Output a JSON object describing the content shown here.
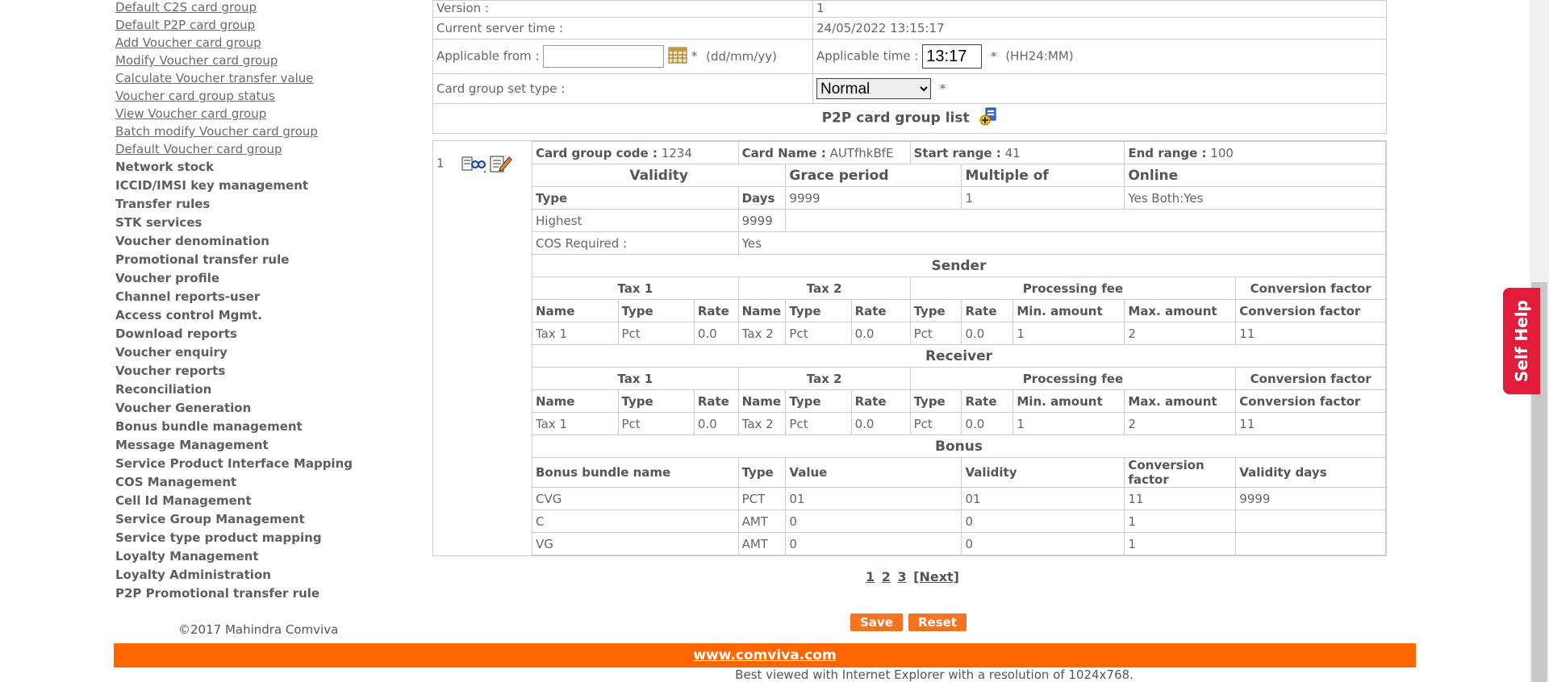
{
  "sidebar": {
    "links": [
      "Default C2S card group",
      "Default P2P card group",
      "Add Voucher card group",
      "Modify Voucher card group",
      "Calculate Voucher transfer value",
      "Voucher card group status",
      "View Voucher card group",
      "Batch modify Voucher card group",
      "Default Voucher card group"
    ],
    "menus": [
      "Network stock",
      "ICCID/IMSI key management",
      "Transfer rules",
      "STK services",
      "Voucher denomination",
      "Promotional transfer rule",
      "Voucher profile",
      "Channel reports-user",
      "Access control Mgmt.",
      "Download reports",
      "Voucher enquiry",
      "Voucher reports",
      "Reconciliation",
      "Voucher Generation",
      "Bonus bundle management",
      "Message Management",
      "Service Product Interface Mapping",
      "COS Management",
      "Cell Id Management",
      "Service Group Management",
      "Service type product mapping",
      "Loyalty Management",
      "Loyalty Administration",
      "P2P Promotional transfer rule"
    ]
  },
  "copyright": "©2017 Mahindra Comviva",
  "form": {
    "version_label": "Version :",
    "version_value": "1",
    "server_time_label": "Current server time :",
    "server_time_value": "24/05/2022 13:15:17",
    "applicable_from_label": "Applicable from :",
    "applicable_from_value": "",
    "date_format": "(dd/mm/yy)",
    "applicable_time_label": "Applicable time :",
    "applicable_time_value": "13:17",
    "time_format": "(HH24:MM)",
    "set_type_label": "Card group set type :",
    "set_type_value": "Normal",
    "required_mark": "*"
  },
  "list_title": "P2P card group list",
  "card": {
    "index": "1",
    "code_label": "Card group code :",
    "code_value": "1234",
    "name_label": "Card Name :",
    "name_value": "AUTfhkBfE",
    "start_label": "Start range :",
    "start_value": "41",
    "end_label": "End range :",
    "end_value": "100",
    "h_validity": "Validity",
    "h_grace": "Grace period",
    "h_multiple": "Multiple of",
    "h_online": "Online",
    "type_label": "Type",
    "days_label": "Days",
    "grace_value": "9999",
    "multiple_value": "1",
    "online_value": "Yes Both:Yes",
    "validity_type": "Highest",
    "validity_days": "9999",
    "cos_label": "COS Required :",
    "cos_value": "Yes",
    "sender_title": "Sender",
    "receiver_title": "Receiver",
    "tax1": "Tax 1",
    "tax2": "Tax 2",
    "processing_fee": "Processing fee",
    "conversion_factor": "Conversion factor",
    "col_name": "Name",
    "col_type": "Type",
    "col_rate": "Rate",
    "col_min": "Min. amount",
    "col_max": "Max. amount",
    "sender": {
      "t1_name": "Tax 1",
      "t1_type": "Pct",
      "t1_rate": "0.0",
      "t2_name": "Tax 2",
      "t2_type": "Pct",
      "t2_rate": "0.0",
      "pf_type": "Pct",
      "pf_rate": "0.0",
      "pf_min": "1",
      "pf_max": "2",
      "conv": "11"
    },
    "receiver": {
      "t1_name": "Tax 1",
      "t1_type": "Pct",
      "t1_rate": "0.0",
      "t2_name": "Tax 2",
      "t2_type": "Pct",
      "t2_rate": "0.0",
      "pf_type": "Pct",
      "pf_rate": "0.0",
      "pf_min": "1",
      "pf_max": "2",
      "conv": "11"
    },
    "bonus_title": "Bonus",
    "bonus_headers": [
      "Bonus bundle name",
      "Type",
      "Value",
      "Validity",
      "Conversion factor",
      "Validity days"
    ],
    "bonus_rows": [
      [
        "CVG",
        "PCT",
        "01",
        "01",
        "11",
        "9999"
      ],
      [
        "C",
        "AMT",
        "0",
        "0",
        "1",
        ""
      ],
      [
        "VG",
        "AMT",
        "0",
        "0",
        "1",
        ""
      ]
    ]
  },
  "paging": {
    "pages": [
      "1",
      "2",
      "3"
    ],
    "next": "[Next]"
  },
  "buttons": {
    "save": "Save",
    "reset": "Reset"
  },
  "footer": {
    "link": "www.comviva.com",
    "note": "Best viewed with Internet Explorer with a resolution of 1024x768."
  },
  "self_help": "Self Help"
}
